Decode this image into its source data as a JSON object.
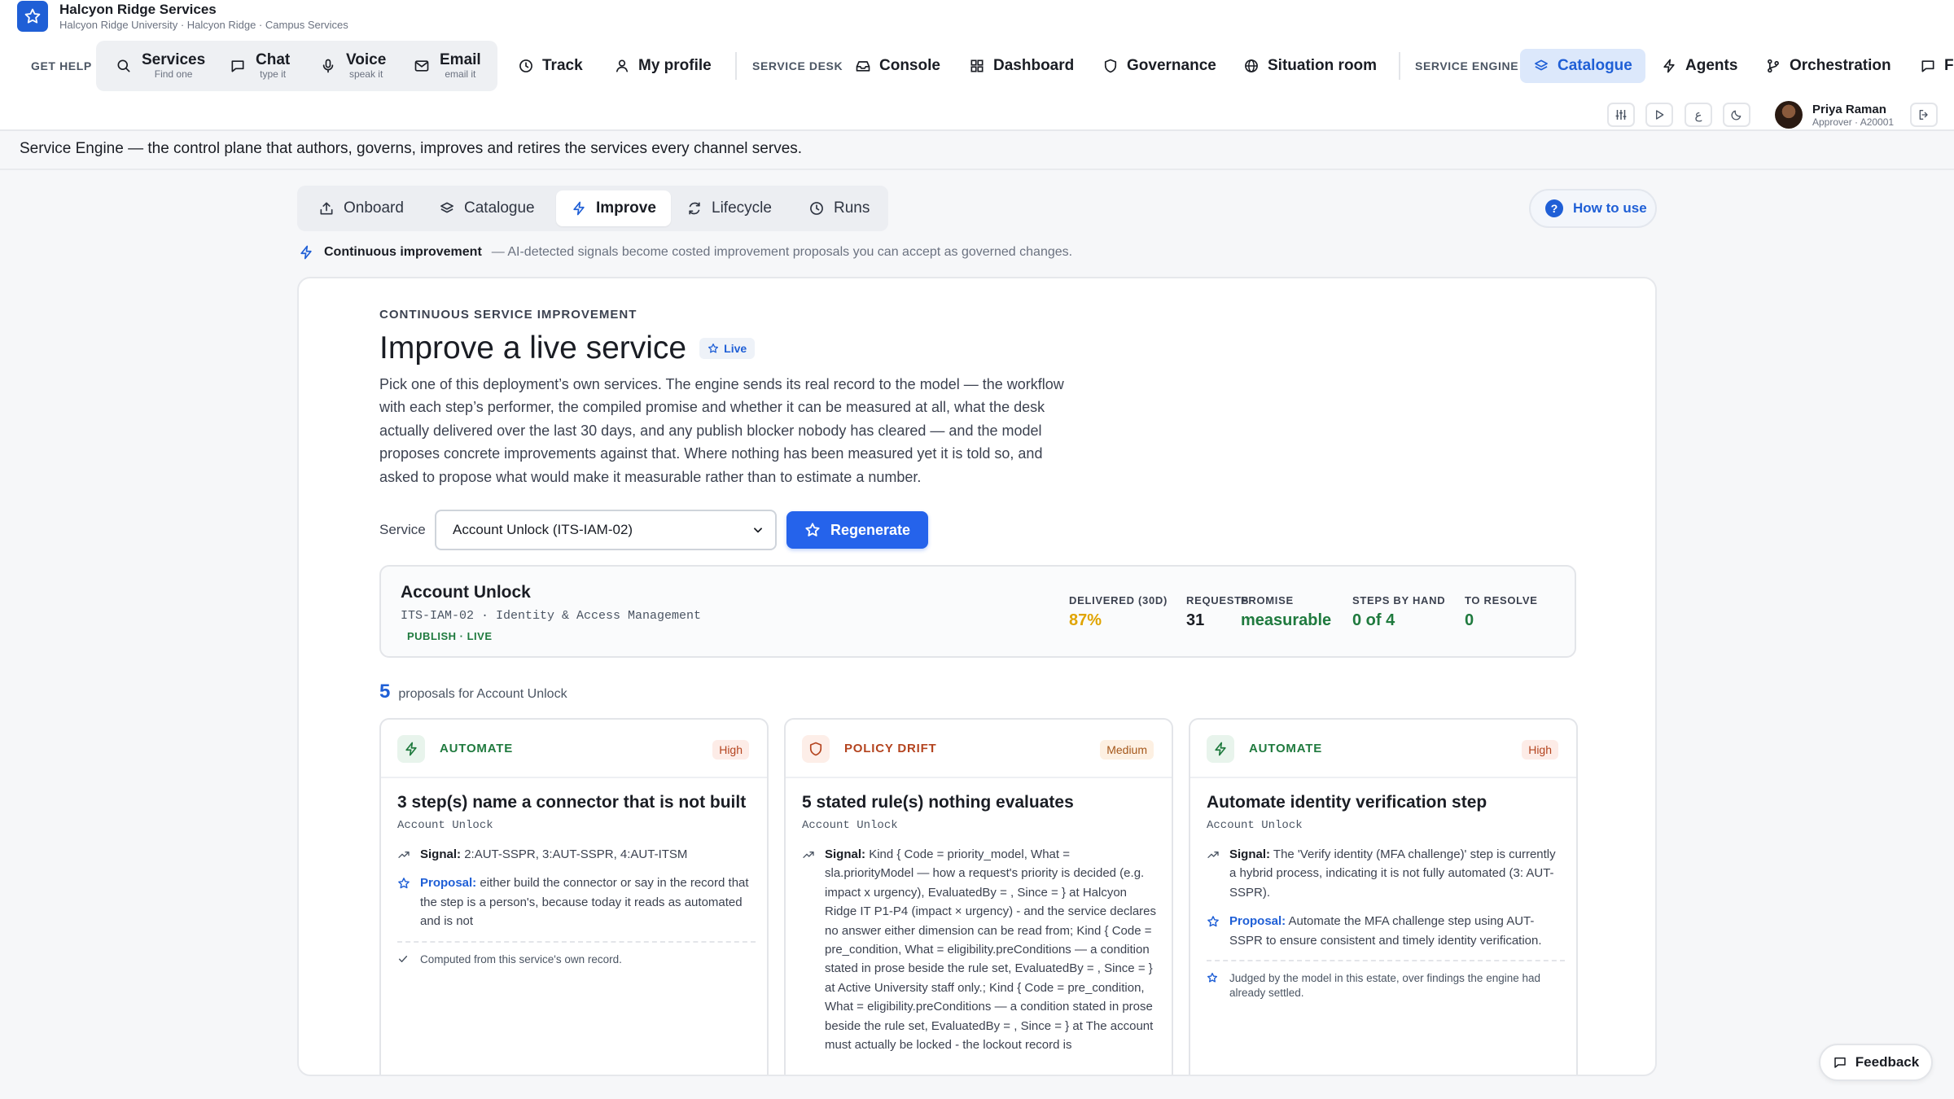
{
  "brand": {
    "title": "Halcyon Ridge Services",
    "subtitle": "Halcyon Ridge University · Halcyon Ridge · Campus Services"
  },
  "nav": {
    "get_help": "GET HELP",
    "help_items": [
      {
        "label": "Services",
        "sub": "Find one",
        "icon": "search-icon"
      },
      {
        "label": "Chat",
        "sub": "type it",
        "icon": "chat-icon"
      },
      {
        "label": "Voice",
        "sub": "speak it",
        "icon": "microphone-icon"
      },
      {
        "label": "Email",
        "sub": "email it",
        "icon": "mail-icon"
      }
    ],
    "track": "Track",
    "my_profile": "My profile",
    "service_desk": "SERVICE DESK",
    "desk_items": [
      "Console",
      "Dashboard",
      "Governance",
      "Situation room"
    ],
    "service_engine": "SERVICE ENGINE",
    "engine_items": [
      "Catalogue",
      "Agents",
      "Orchestration",
      "F"
    ],
    "active_item": "Catalogue"
  },
  "user": {
    "name": "Priya Raman",
    "role": "Approver · A20001"
  },
  "tagline": "Service Engine — the control plane that authors, governs, improves and retires the services every channel serves.",
  "subtabs": [
    "Onboard",
    "Catalogue",
    "Improve",
    "Lifecycle",
    "Runs"
  ],
  "active_subtab": "Improve",
  "how_to_use": "How to use",
  "ci": {
    "title": "Continuous improvement",
    "desc": "— AI-detected signals become costed improvement proposals you can accept as governed changes."
  },
  "main": {
    "eyebrow": "CONTINUOUS SERVICE IMPROVEMENT",
    "title": "Improve a live service",
    "live": "Live",
    "intro": "Pick one of this deployment’s own services. The engine sends its real record to the model — the workflow with each step’s performer, the compiled promise and whether it can be measured at all, what the desk actually delivered over the last 30 days, and any publish blocker nobody has cleared — and the model proposes concrete improvements against that. Where nothing has been measured yet it is told so, and asked to propose what would make it measurable rather than to estimate a number.",
    "service_label": "Service",
    "service_value": "Account Unlock (ITS-IAM-02)",
    "regenerate": "Regenerate"
  },
  "summary": {
    "title": "Account Unlock",
    "code": "ITS-IAM-02 · Identity & Access Management",
    "badge": "PUBLISH · LIVE",
    "metrics": [
      {
        "k": "DELIVERED (30D)",
        "v": "87%",
        "color": "#e0a400"
      },
      {
        "k": "REQUESTS",
        "v": "31",
        "color": "#1a1d24"
      },
      {
        "k": "PROMISE",
        "v": "measurable",
        "color": "#1f7a3e"
      },
      {
        "k": "STEPS BY HAND",
        "v": "0 of 4",
        "color": "#1f7a3e"
      },
      {
        "k": "TO RESOLVE",
        "v": "0",
        "color": "#1f7a3e"
      }
    ]
  },
  "proposals_count": "5",
  "proposals_label": "proposals for Account Unlock",
  "proposals": [
    {
      "kind": "AUTOMATE",
      "severity": "High",
      "title": "3 step(s) name a connector that is not built",
      "service": "Account Unlock",
      "signal_label": "Signal:",
      "signal": "2:AUT-SSPR, 3:AUT-SSPR, 4:AUT-ITSM",
      "proposal_label": "Proposal:",
      "proposal": "either build the connector or say in the record that the step is a person's, because today it reads as automated and is not",
      "footer": "Computed from this service's own record."
    },
    {
      "kind": "POLICY DRIFT",
      "severity": "Medium",
      "title": "5 stated rule(s) nothing evaluates",
      "service": "Account Unlock",
      "signal_label": "Signal:",
      "signal": "Kind { Code = priority_model, What = sla.priorityModel — how a request's priority is decided (e.g. impact x urgency), EvaluatedBy = , Since = } at Halcyon Ridge IT P1-P4 (impact × urgency) - and the service declares no answer either dimension can be read from; Kind { Code = pre_condition, What = eligibility.preConditions — a condition stated in prose beside the rule set, EvaluatedBy = , Since = } at Active University staff only.; Kind { Code = pre_condition, What = eligibility.preConditions — a condition stated in prose beside the rule set, EvaluatedBy = , Since = } at The account must actually be locked - the lockout record is",
      "proposal_label": "",
      "proposal": "",
      "footer": ""
    },
    {
      "kind": "AUTOMATE",
      "severity": "High",
      "title": "Automate identity verification step",
      "service": "Account Unlock",
      "signal_label": "Signal:",
      "signal": "The 'Verify identity (MFA challenge)' step is currently a hybrid process, indicating it is not fully automated (3: AUT-SSPR).",
      "proposal_label": "Proposal:",
      "proposal": "Automate the MFA challenge step using AUT-SSPR to ensure consistent and timely identity verification.",
      "footer": "Judged by the model in this estate, over findings the engine had already settled."
    }
  ],
  "feedback": "Feedback"
}
